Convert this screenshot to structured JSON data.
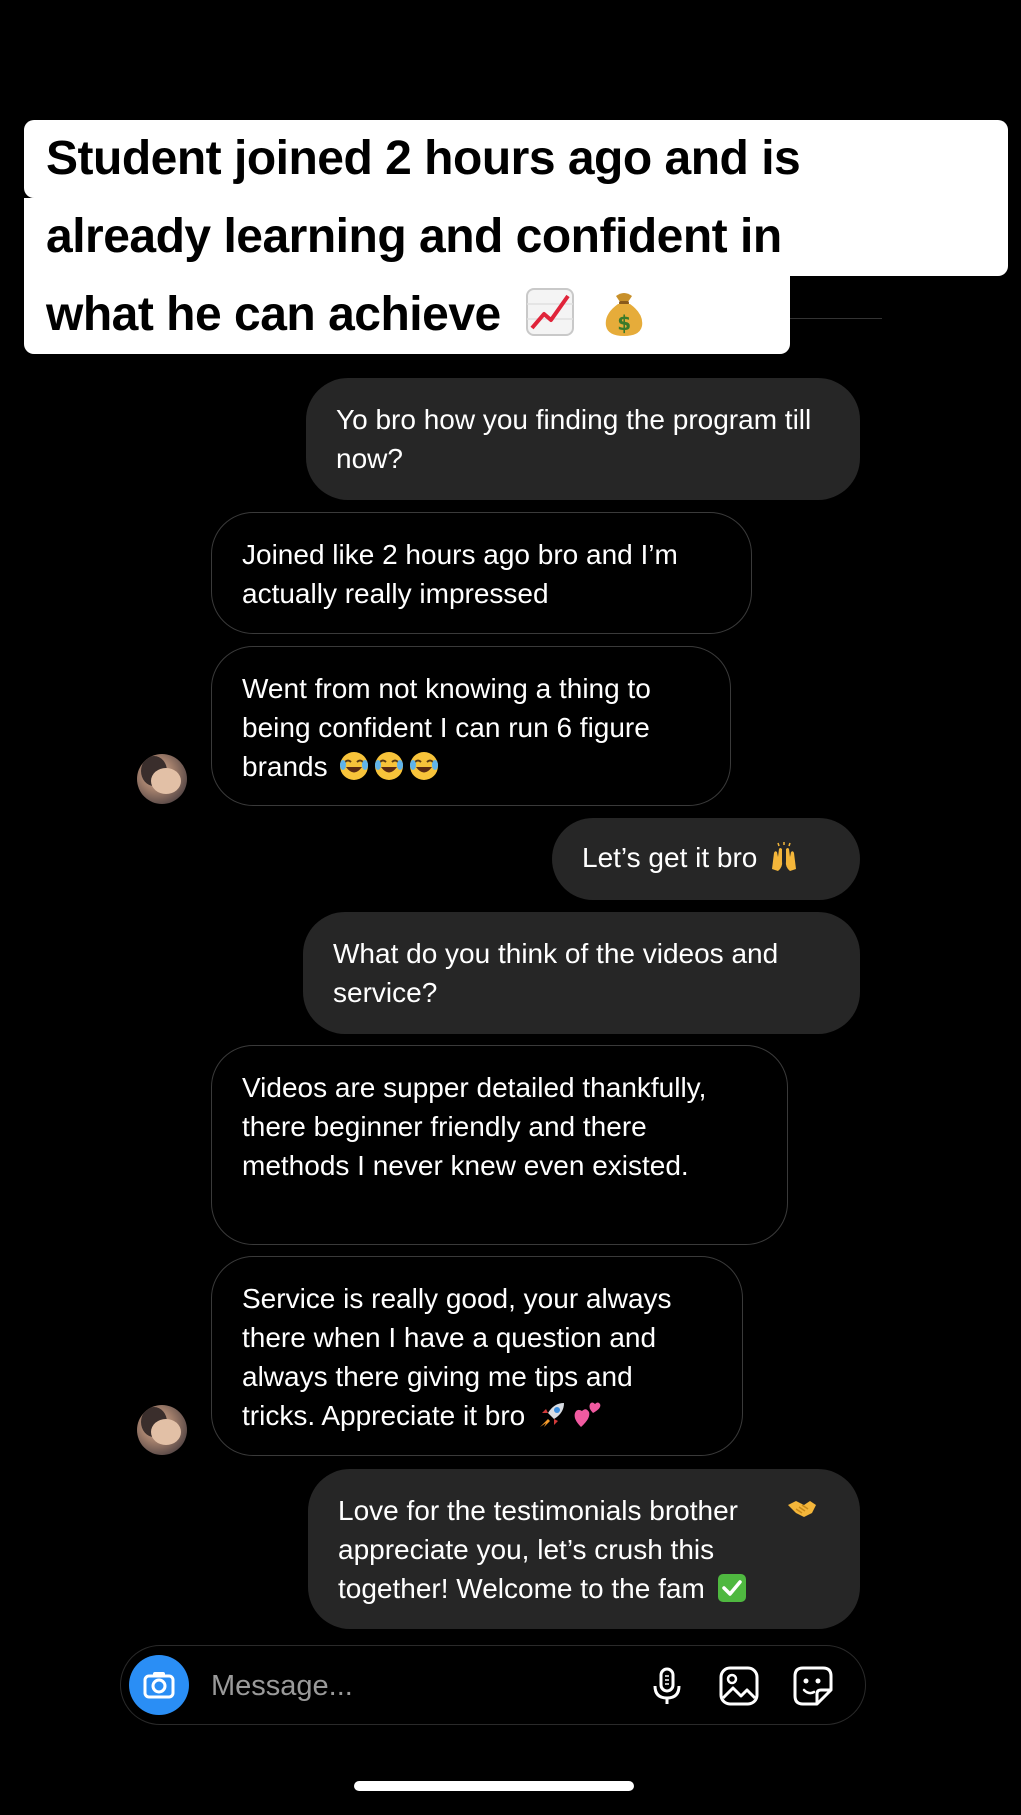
{
  "caption": {
    "line1": "Student joined 2 hours ago and is",
    "line2": "already learning and confident in",
    "line3": "what he can achieve",
    "emojis": [
      "chart-increasing-emoji",
      "money-bag-emoji"
    ]
  },
  "messages": [
    {
      "side": "sent",
      "text": "Yo bro how you finding the program till now?"
    },
    {
      "side": "received",
      "text": "Joined like 2 hours ago bro and I’m actually really impressed"
    },
    {
      "side": "received",
      "text": "Went from not knowing a thing to being confident I can run 6 figure brands",
      "emojis": [
        "tears-of-joy-emoji",
        "tears-of-joy-emoji",
        "tears-of-joy-emoji"
      ]
    },
    {
      "side": "sent",
      "text": "Let’s get it bro",
      "emojis": [
        "raising-hands-emoji"
      ]
    },
    {
      "side": "sent",
      "text": "What do you think of the videos and service?"
    },
    {
      "side": "received",
      "text": "Videos are supper detailed thankfully, there beginner friendly and there methods I never knew even existed."
    },
    {
      "side": "received",
      "text": "Service is really good, your always there when I have a question and always there giving me tips and tricks. Appreciate it bro",
      "emojis": [
        "rocket-emoji",
        "two-hearts-emoji"
      ]
    },
    {
      "side": "sent",
      "text": "Love for the testimonials brother appreciate you, let’s crush this together! Welcome to the fam",
      "emojis": [
        "handshake-emoji",
        "check-mark-emoji"
      ]
    }
  ],
  "composer": {
    "placeholder": "Message...",
    "icons": [
      "camera-icon",
      "microphone-icon",
      "gallery-icon",
      "sticker-icon"
    ]
  },
  "colors": {
    "background": "#000000",
    "sent_bubble": "#262626",
    "received_border": "#3a3a3a",
    "camera_button": "#2a8ef5",
    "caption_background": "#ffffff"
  }
}
